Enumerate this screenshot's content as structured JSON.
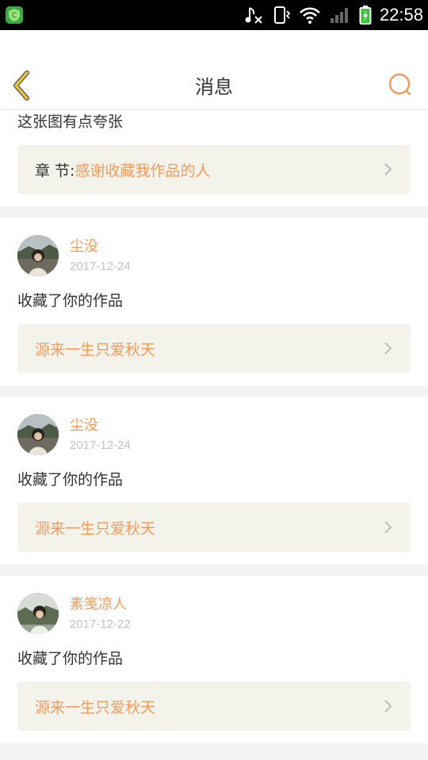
{
  "status_bar": {
    "time": "22:58",
    "icons": [
      "app-shield-icon",
      "music-muted-icon",
      "vibrate-icon",
      "wifi-icon",
      "signal-icon",
      "battery-icon"
    ]
  },
  "header": {
    "title": "消息",
    "back_icon": "back-arrow-icon",
    "search_icon": "search-icon"
  },
  "colors": {
    "accent": "#f39a5a",
    "back_arrow": "#e8c33a",
    "link_background": "#f3f3ec"
  },
  "notifications": [
    {
      "comment": "这张图有点夸张",
      "link_prefix": "章 节:",
      "link_title": "感谢收藏我作品的人"
    },
    {
      "user": "尘没",
      "date": "2017-12-24",
      "comment": "收藏了你的作品",
      "link_title": "源来一生只爱秋天"
    },
    {
      "user": "尘没",
      "date": "2017-12-24",
      "comment": "收藏了你的作品",
      "link_title": "源来一生只爱秋天"
    },
    {
      "user": "素笺凉人",
      "date": "2017-12-22",
      "comment": "收藏了你的作品",
      "link_title": "源来一生只爱秋天"
    }
  ]
}
